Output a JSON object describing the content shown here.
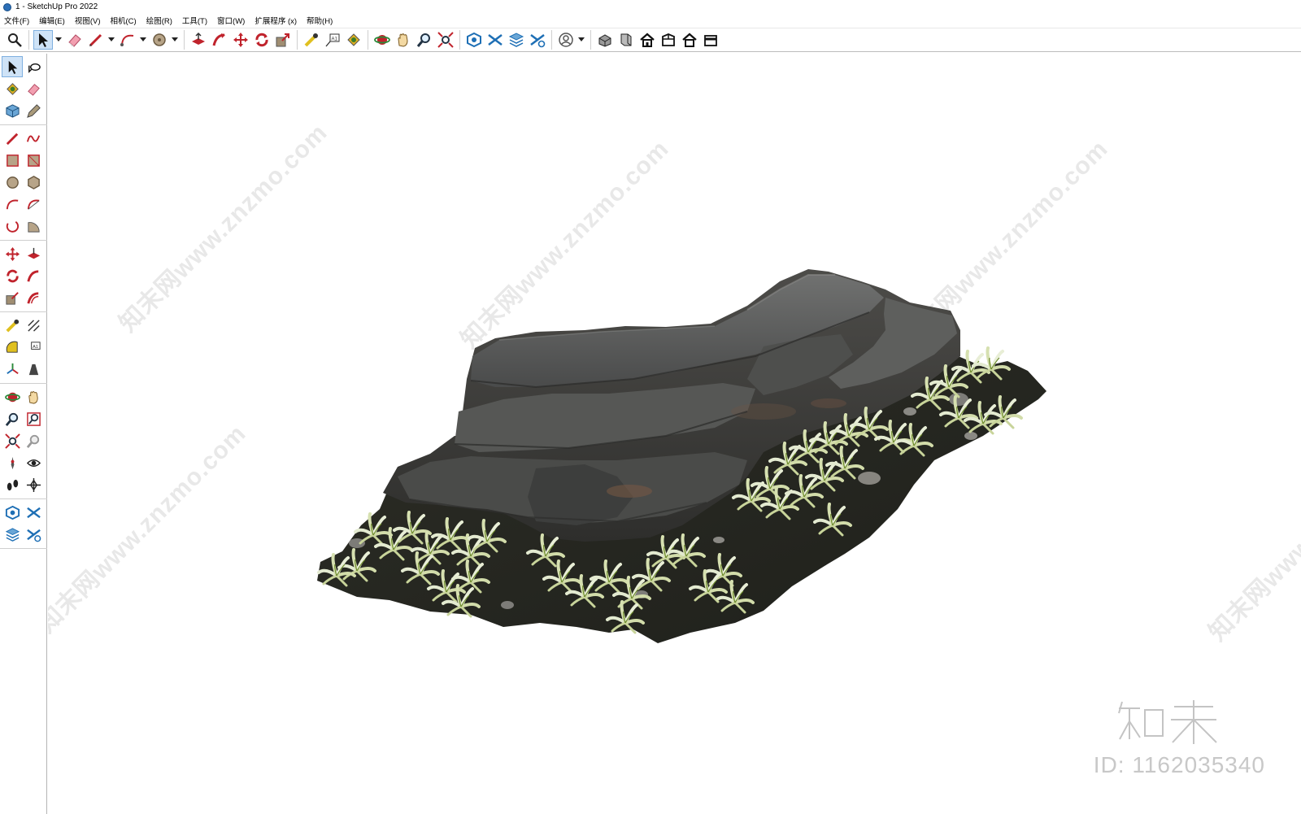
{
  "window": {
    "title": "1 - SketchUp Pro 2022"
  },
  "menu": [
    "文件(F)",
    "编辑(E)",
    "视图(V)",
    "相机(C)",
    "绘图(R)",
    "工具(T)",
    "窗口(W)",
    "扩展程序 (x)",
    "帮助(H)"
  ],
  "toolbar_icons": [
    "search-icon",
    "select-icon",
    "eraser-icon",
    "pencil-icon",
    "arc-icon",
    "circle-icon",
    "pushpull-icon",
    "followme-icon",
    "move-icon",
    "rotate-icon",
    "scale-icon",
    "tape-icon",
    "text-icon",
    "paint-icon",
    "orbit-icon",
    "pan-icon",
    "zoom-icon",
    "zoom-extents-icon",
    "warehouse-icon",
    "extension-warehouse-icon",
    "layer-icon",
    "styles-icon",
    "account-icon",
    "iso-view-icon",
    "top-view-icon",
    "front-view-icon",
    "right-view-icon",
    "back-view-icon",
    "left-view-icon"
  ],
  "left_toolbar_icons": [
    "select-icon",
    "orbit-small-icon",
    "paint-bucket-icon",
    "eraser-icon",
    "component-icon",
    "tag-icon",
    "line-icon",
    "freehand-icon",
    "rectangle-icon",
    "rotated-rect-icon",
    "circle-icon",
    "polygon-icon",
    "arc-icon",
    "arc-2pt-icon",
    "arc-3pt-icon",
    "pie-icon",
    "move-icon",
    "pushpull-icon",
    "rotate-icon",
    "followme-icon",
    "scale-icon",
    "offset-icon",
    "tape-icon",
    "dimension-icon",
    "protractor-icon",
    "text-icon",
    "axes-icon",
    "3d-text-icon",
    "orbit-icon",
    "pan-icon",
    "zoom-icon",
    "zoom-window-icon",
    "zoom-extents-icon",
    "previous-view-icon",
    "position-camera-icon",
    "look-around-icon",
    "walk-icon",
    "section-plane-icon",
    "warehouse-icon",
    "extension-warehouse-icon",
    "layers-icon",
    "styles-icon"
  ],
  "watermark": {
    "text": "知末网www.znzmo.com",
    "logo_text": "知末",
    "id_text": "ID: 1162035340"
  },
  "colors": {
    "accent": "#2c6fb7",
    "rock_dark": "#3d3f41",
    "rock_light": "#6d6e6b",
    "soil": "#2a2b24",
    "plant": "#d8e2b4"
  }
}
